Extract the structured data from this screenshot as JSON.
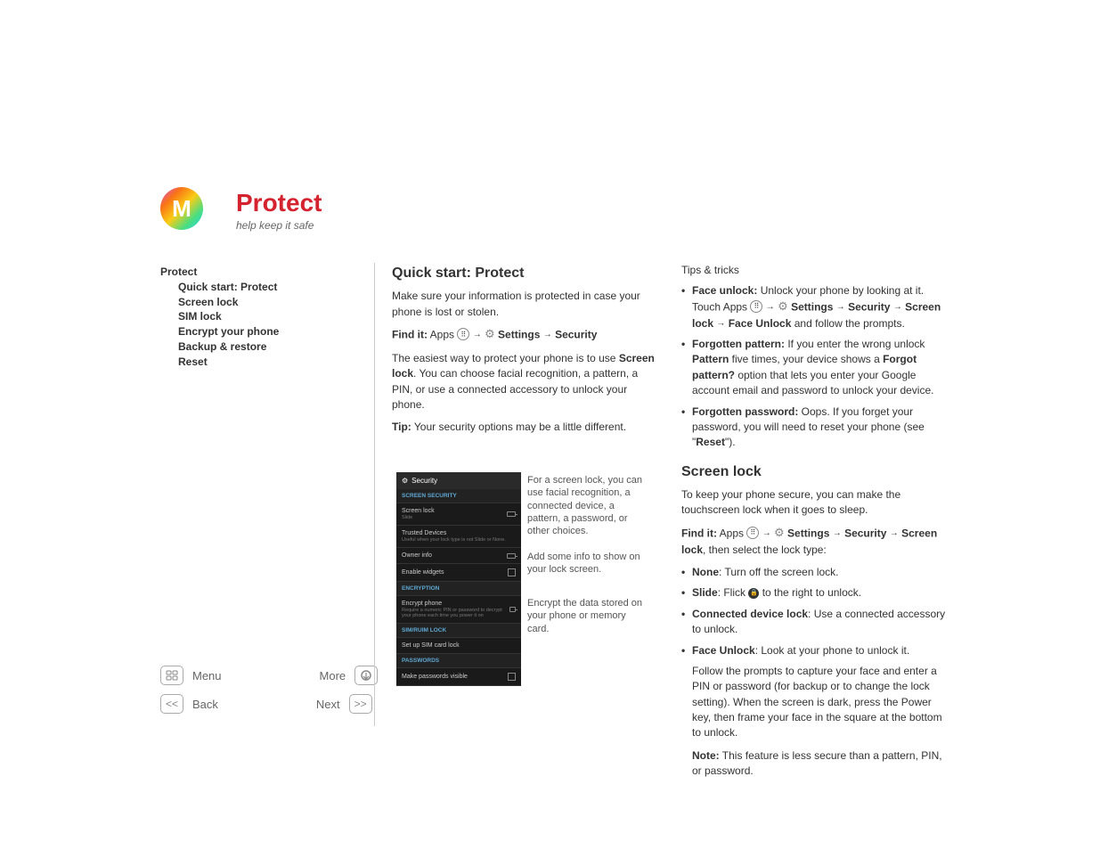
{
  "header": {
    "title": "Protect",
    "subtitle": "help keep it safe"
  },
  "sidebar": {
    "main": "Protect",
    "items": [
      "Quick start: Protect",
      "Screen lock",
      "SIM lock",
      "Encrypt your phone",
      "Backup & restore",
      "Reset"
    ]
  },
  "navbuttons": {
    "menu": "Menu",
    "more": "More",
    "back": "Back",
    "next": "Next"
  },
  "col1": {
    "h2": "Quick start: Protect",
    "p1": "Make sure your information is protected in case your phone is lost or stolen.",
    "findit_label": "Find it:",
    "findit_apps": "Apps",
    "findit_settings": "Settings",
    "findit_security": "Security",
    "p2a": "The easiest way to protect your phone is to use ",
    "p2b": "Screen lock",
    "p2c": ". You can choose facial recognition, a pattern, a PIN, or use a connected accessory to unlock your phone.",
    "tip_label": "Tip:",
    "tip_text": " Your security options may be a little different."
  },
  "phone": {
    "title": "Security",
    "sec1": "SCREEN SECURITY",
    "r1": "Screen lock",
    "r1sub": "Slide",
    "r2": "Trusted Devices",
    "r2sub": "Useful when your lock type is not Slide or None.",
    "r3": "Owner info",
    "r4": "Enable widgets",
    "sec2": "ENCRYPTION",
    "r5": "Encrypt phone",
    "r5sub": "Require a numeric PIN or password to decrypt your phone each time you power it on",
    "sec3": "SIM/RUIM LOCK",
    "r6": "Set up SIM card lock",
    "sec4": "PASSWORDS",
    "r7": "Make passwords visible"
  },
  "callouts": {
    "c1": "For a screen lock, you can use facial recognition, a connected device, a pattern, a password, or other choices.",
    "c2": "Add some info to show on your lock screen.",
    "c3": "Encrypt the data stored on your phone or memory card."
  },
  "col2": {
    "tips_title": "Tips & tricks",
    "tip1_lead": "Face unlock:",
    "tip1_a": " Unlock your phone by looking at it. Touch Apps ",
    "tip1_settings": "Settings",
    "tip1_security": "Security",
    "tip1_screenlock": "Screen lock",
    "tip1_faceunlock": "Face Unlock",
    "tip1_end": " and follow the prompts.",
    "tip2_lead": "Forgotten pattern:",
    "tip2_a": " If you enter the wrong unlock ",
    "tip2_pattern": "Pattern",
    "tip2_b": " five times, your device shows a ",
    "tip2_forgot": "Forgot pattern?",
    "tip2_c": " option that lets you enter your Google account email and password to unlock your device.",
    "tip3_lead": "Forgotten password:",
    "tip3_a": " Oops. If you forget your password, you will need to reset your phone (see \"",
    "tip3_reset": "Reset",
    "tip3_b": "\").",
    "h2": "Screen lock",
    "p1": "To keep your phone secure, you can make the touchscreen lock when it goes to sleep.",
    "findit_label": "Find it:",
    "findit_apps": "Apps",
    "findit_settings": "Settings",
    "findit_security": "Security",
    "findit_screenlock": "Screen lock",
    "findit_end": ", then select the lock type:",
    "opt1_lead": "None",
    "opt1": ": Turn off the screen lock.",
    "opt2_lead": "Slide",
    "opt2a": ": Flick ",
    "opt2b": " to the right to unlock.",
    "opt3_lead": "Connected device lock",
    "opt3": ": Use a connected accessory to unlock.",
    "opt4_lead": "Face Unlock",
    "opt4": ": Look at your phone to unlock it.",
    "opt4_p": "Follow the prompts to capture your face and enter a PIN or password (for backup or to change the lock setting). When the screen is dark, press the Power key, then frame your face in the square at the bottom to unlock.",
    "note_lead": "Note:",
    "note": " This feature is less secure than a pattern, PIN, or password."
  }
}
